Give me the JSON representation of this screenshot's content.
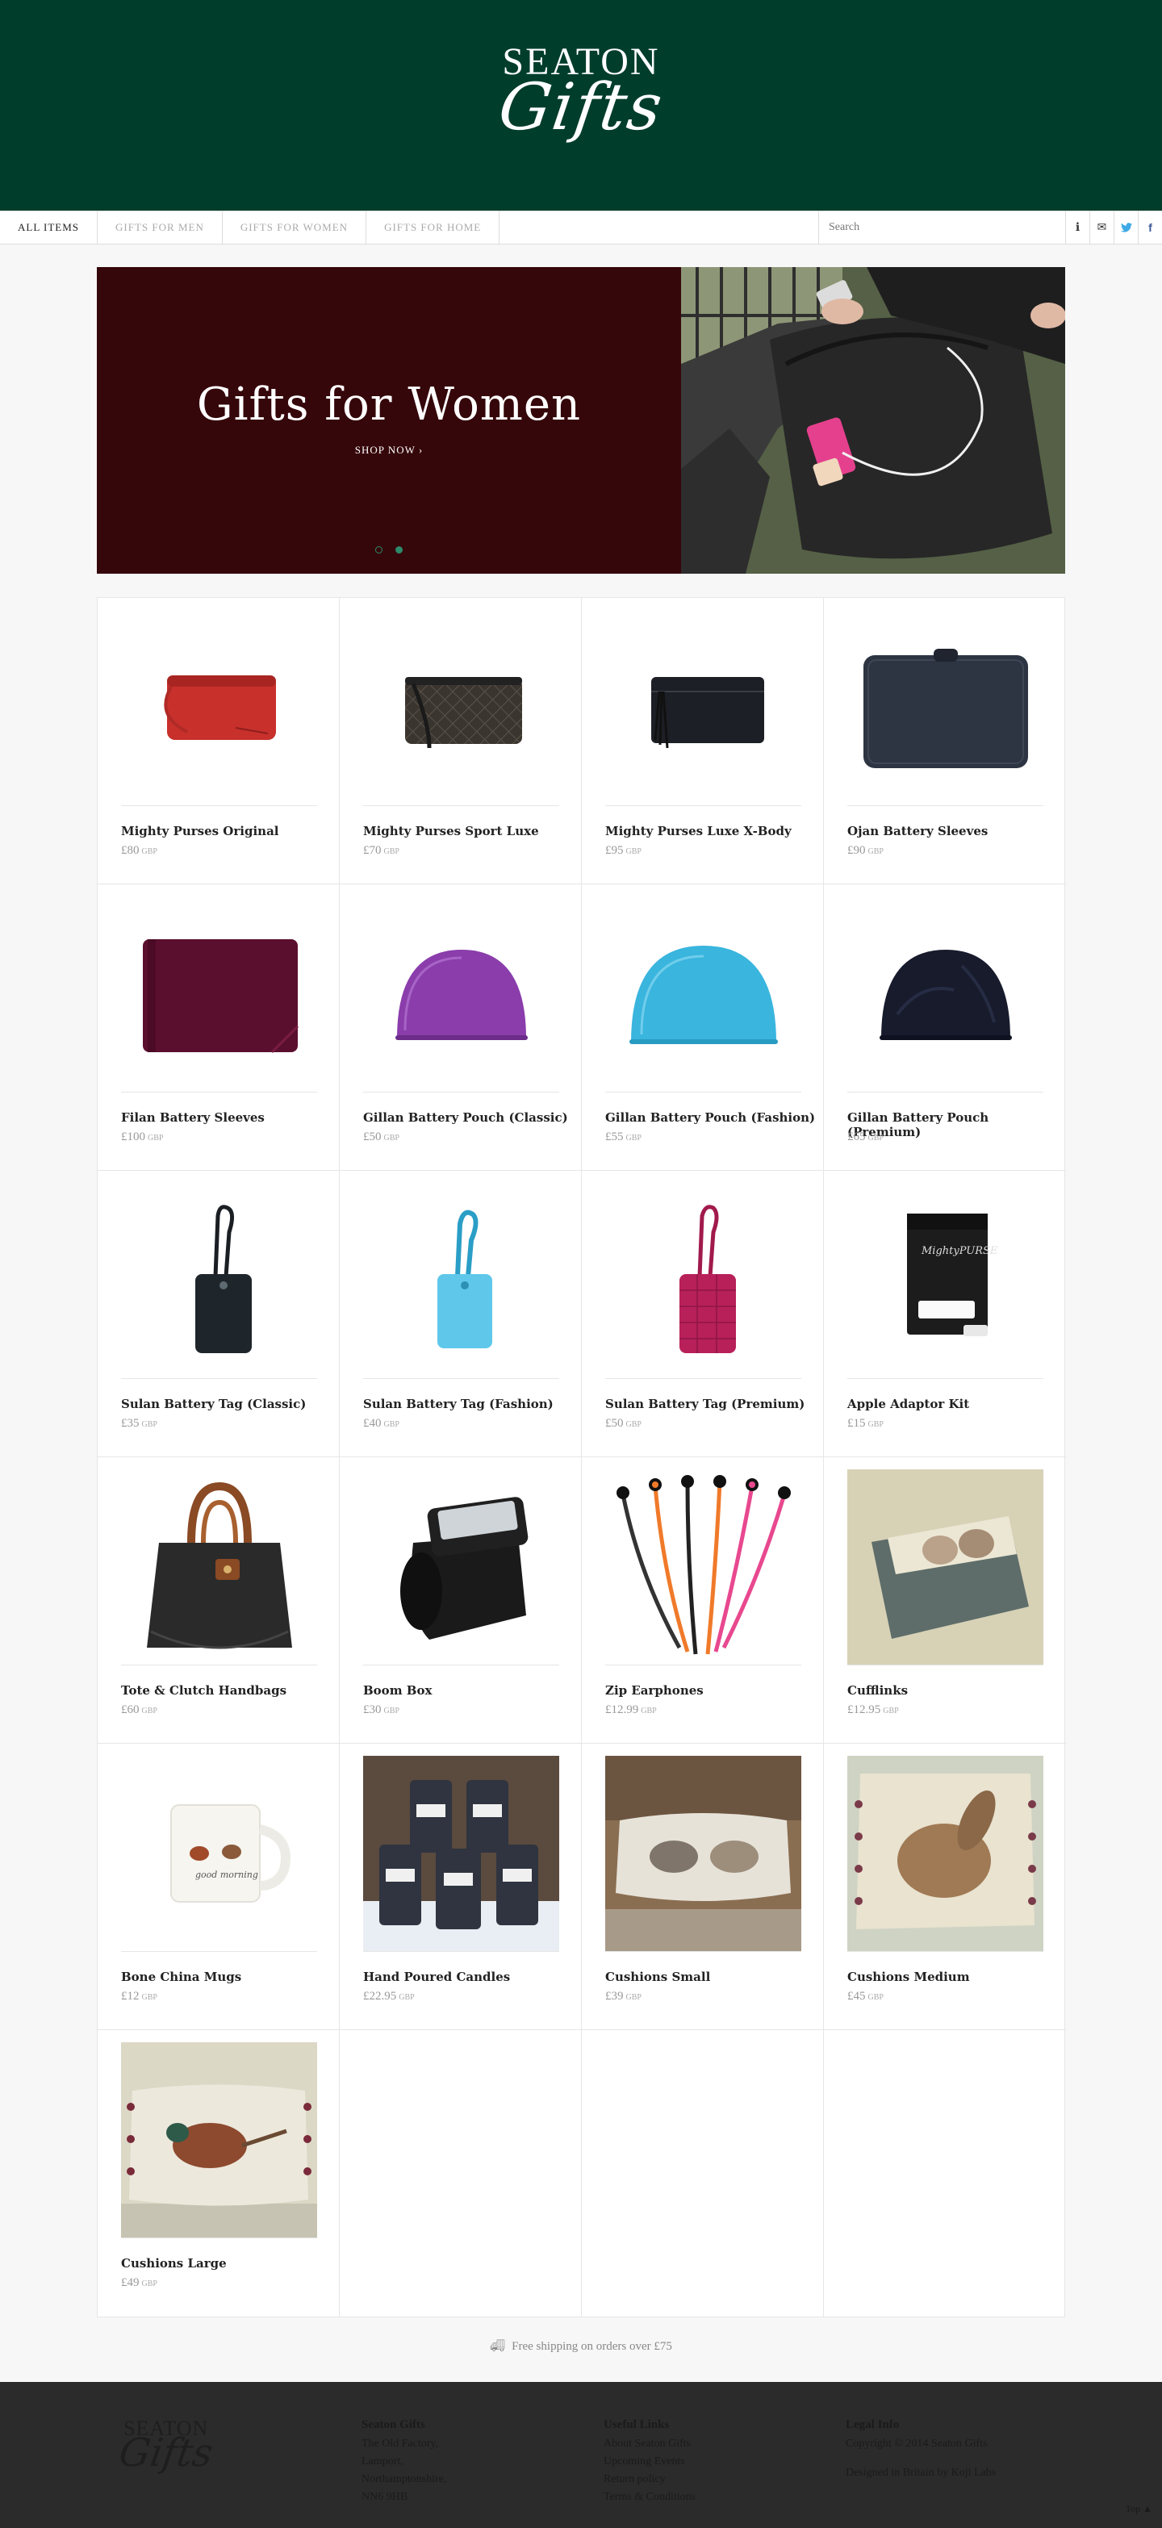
{
  "header": {
    "logo_top": "SEATON",
    "logo_script": "Gifts"
  },
  "nav": {
    "items": [
      {
        "label": "ALL ITEMS"
      },
      {
        "label": "GIFTS FOR MEN"
      },
      {
        "label": "GIFTS FOR WOMEN"
      },
      {
        "label": "GIFTS FOR HOME"
      }
    ],
    "search_placeholder": "Search",
    "icons": [
      "info-icon",
      "envelope-icon",
      "twitter-icon",
      "facebook-icon"
    ]
  },
  "hero": {
    "title": "Gifts for Women",
    "cta": "SHOP NOW ›",
    "slides": 2,
    "active_slide": 1,
    "bg_color": "#35060a"
  },
  "products": [
    {
      "name": "Mighty Purses Original",
      "price": "£80",
      "currency": "GBP"
    },
    {
      "name": "Mighty Purses Sport Luxe",
      "price": "£70",
      "currency": "GBP"
    },
    {
      "name": "Mighty Purses Luxe X-Body",
      "price": "£95",
      "currency": "GBP"
    },
    {
      "name": "Ojan Battery Sleeves",
      "price": "£90",
      "currency": "GBP"
    },
    {
      "name": "Filan Battery Sleeves",
      "price": "£100",
      "currency": "GBP"
    },
    {
      "name": "Gillan Battery Pouch (Classic)",
      "price": "£50",
      "currency": "GBP"
    },
    {
      "name": "Gillan Battery Pouch (Fashion)",
      "price": "£55",
      "currency": "GBP"
    },
    {
      "name": "Gillan Battery Pouch (Premium)",
      "price": "£65",
      "currency": "GBP"
    },
    {
      "name": "Sulan Battery Tag (Classic)",
      "price": "£35",
      "currency": "GBP"
    },
    {
      "name": "Sulan Battery Tag (Fashion)",
      "price": "£40",
      "currency": "GBP"
    },
    {
      "name": "Sulan Battery Tag (Premium)",
      "price": "£50",
      "currency": "GBP"
    },
    {
      "name": "Apple Adaptor Kit",
      "price": "£15",
      "currency": "GBP"
    },
    {
      "name": "Tote & Clutch Handbags",
      "price": "£60",
      "currency": "GBP"
    },
    {
      "name": "Boom Box",
      "price": "£30",
      "currency": "GBP"
    },
    {
      "name": "Zip Earphones",
      "price": "£12.99",
      "currency": "GBP"
    },
    {
      "name": "Cufflinks",
      "price": "£12.95",
      "currency": "GBP"
    },
    {
      "name": "Bone China Mugs",
      "price": "£12",
      "currency": "GBP"
    },
    {
      "name": "Hand Poured Candles",
      "price": "£22.95",
      "currency": "GBP"
    },
    {
      "name": "Cushions Small",
      "price": "£39",
      "currency": "GBP"
    },
    {
      "name": "Cushions Medium",
      "price": "£45",
      "currency": "GBP"
    },
    {
      "name": "Cushions Large",
      "price": "£49",
      "currency": "GBP"
    }
  ],
  "shipping": {
    "text": "Free shipping on orders over £75"
  },
  "footer": {
    "logo_top": "SEATON",
    "logo_script": "Gifts",
    "address": {
      "title": "Seaton Gifts",
      "lines": [
        "The Old Factory,",
        "Lamport,",
        "Northamptonshire,",
        "NN6 9HB"
      ]
    },
    "useful": {
      "title": "Useful Links",
      "links": [
        "About Seaton Gifts",
        "Upcoming Events",
        "Return policy",
        "Terms & Conditions"
      ]
    },
    "legal": {
      "title": "Legal Info",
      "copyright": "Copyright © 2014 Seaton Gifts",
      "credit": "Designed in Britain by Koji Labs"
    },
    "back_to_top": "Top ▲"
  },
  "colors": {
    "header_bg": "#003d2b",
    "footer_bg": "#2b2b2b",
    "accent": "#2c8a6a"
  }
}
